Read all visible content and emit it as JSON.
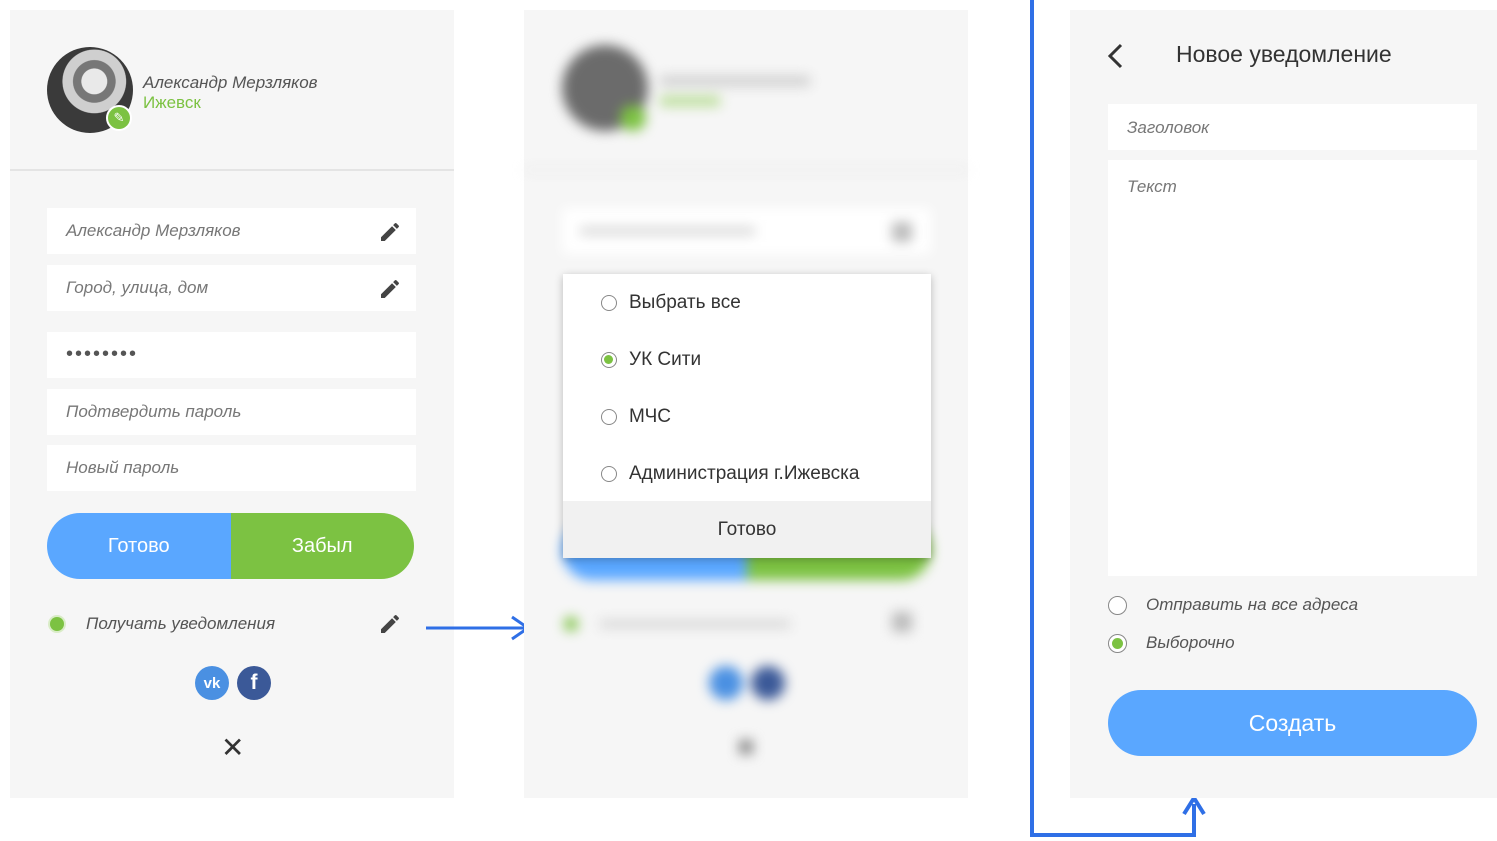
{
  "colors": {
    "accent_blue": "#5aa7ff",
    "accent_green": "#7cc242",
    "panel_bg": "#f6f6f6",
    "arrow_blue": "#2f6fe6"
  },
  "profile": {
    "name": "Александр Мерзляков",
    "city": "Ижевск",
    "fields": {
      "name_value": "Александр Мерзляков",
      "address_placeholder": "Город, улица, дом",
      "password_mask": "••••••••",
      "confirm_placeholder": "Подтвердить пароль",
      "new_password_placeholder": "Новый пароль"
    },
    "done_label": "Готово",
    "forgot_label": "Забыл",
    "notifications_label": "Получать уведомления",
    "social": {
      "vk": "vk-icon",
      "facebook": "facebook-icon",
      "vk_glyph": "vk",
      "fb_glyph": "f"
    },
    "close_glyph": "✕"
  },
  "popup": {
    "options": [
      {
        "label": "Выбрать все",
        "selected": false
      },
      {
        "label": "УК Сити",
        "selected": true
      },
      {
        "label": "МЧС",
        "selected": false
      },
      {
        "label": "Администрация г.Ижевска",
        "selected": false
      }
    ],
    "done_label": "Готово"
  },
  "new_notification": {
    "title": "Новое уведомление",
    "heading_placeholder": "Заголовок",
    "text_placeholder": "Текст",
    "options": [
      {
        "label": "Отправить на все адреса",
        "selected": false
      },
      {
        "label": "Выборочно",
        "selected": true
      }
    ],
    "create_label": "Создать"
  }
}
